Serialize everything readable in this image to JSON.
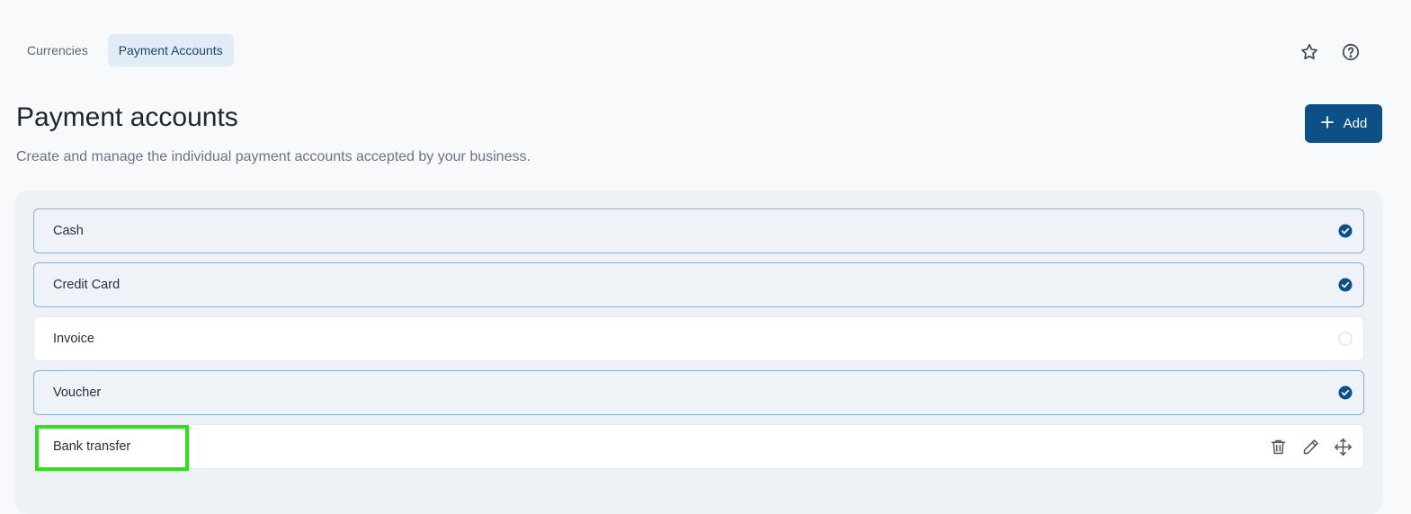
{
  "tabs": [
    {
      "label": "Currencies",
      "active": false
    },
    {
      "label": "Payment Accounts",
      "active": true
    }
  ],
  "header_icons": [
    "star-icon",
    "help-circle-icon"
  ],
  "page": {
    "title": "Payment accounts",
    "subtitle": "Create and manage the individual payment accounts accepted by your business."
  },
  "add_button": {
    "label": "Add",
    "icon": "plus-icon"
  },
  "accounts": [
    {
      "name": "Cash",
      "state": "checked"
    },
    {
      "name": "Credit Card",
      "state": "checked"
    },
    {
      "name": "Invoice",
      "state": "unchecked"
    },
    {
      "name": "Voucher",
      "state": "checked"
    },
    {
      "name": "Bank transfer",
      "state": "hover",
      "actions": [
        "trash-icon",
        "pencil-icon",
        "move-icon"
      ]
    }
  ],
  "colors": {
    "accent": "#0d4f87",
    "active_tab_bg": "#e1ecf7",
    "highlight": "#2ee01a"
  }
}
